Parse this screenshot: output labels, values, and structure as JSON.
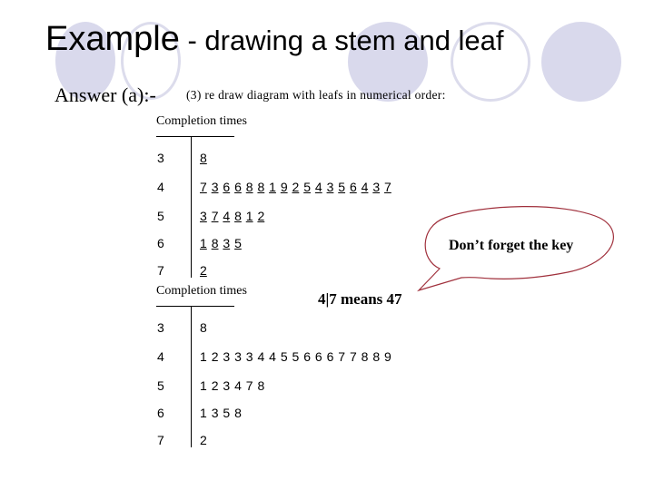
{
  "slide": {
    "title_main": "Example",
    "title_rest": " - drawing a stem and leaf",
    "answer_label": "Answer (a):-",
    "instruction": "(3)  re draw diagram with leafs in numerical order:",
    "key_text": "4|7 means  47",
    "callout_text": "Don’t forget the key",
    "accent_color": "#d9d9ec",
    "callout_border_color": "#a0303c"
  },
  "plots": {
    "unsorted": {
      "heading": "Completion times",
      "rows": [
        {
          "stem": "3",
          "leaves": [
            "8"
          ]
        },
        {
          "stem": "4",
          "leaves": [
            "7",
            "3",
            "6",
            "6",
            "8",
            "8",
            "1",
            "9",
            "2",
            "5",
            "4",
            "3",
            "5",
            "6",
            "4",
            "3",
            "7"
          ]
        },
        {
          "stem": "5",
          "leaves": [
            "3",
            "7",
            "4",
            "8",
            "1",
            "2"
          ]
        },
        {
          "stem": "6",
          "leaves": [
            "1",
            "8",
            "3",
            "5"
          ]
        },
        {
          "stem": "7",
          "leaves": [
            "2"
          ]
        }
      ]
    },
    "sorted": {
      "heading": "Completion times",
      "rows": [
        {
          "stem": "3",
          "leaves": [
            "8"
          ]
        },
        {
          "stem": "4",
          "leaves": [
            "1",
            "2",
            "3",
            "3",
            "3",
            "4",
            "4",
            "5",
            "5",
            "6",
            "6",
            "6",
            "7",
            "7",
            "8",
            "8",
            "9"
          ]
        },
        {
          "stem": "5",
          "leaves": [
            "1",
            "2",
            "3",
            "4",
            "7",
            "8"
          ]
        },
        {
          "stem": "6",
          "leaves": [
            "1",
            "3",
            "5",
            "8"
          ]
        },
        {
          "stem": "7",
          "leaves": [
            "2"
          ]
        }
      ]
    }
  }
}
